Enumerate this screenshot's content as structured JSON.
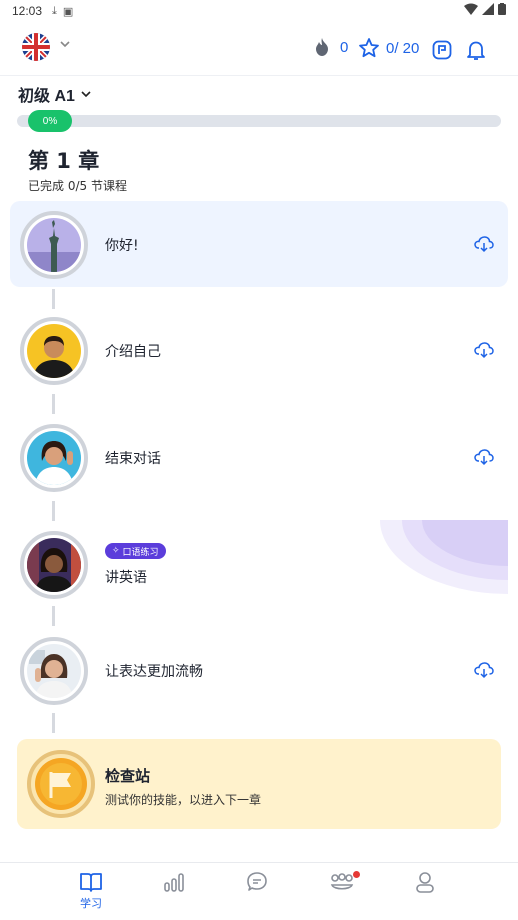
{
  "status_bar": {
    "time": "12:03"
  },
  "header": {
    "streak_count": "0",
    "stars_count": "0/ 20"
  },
  "level": {
    "label": "初级 A1",
    "progress_text": "0%",
    "progress": 0
  },
  "chapter": {
    "title": "第 1 章",
    "subtitle": "已完成 0/5 节课程"
  },
  "lessons": [
    {
      "label": "你好!"
    },
    {
      "label": "介绍自己"
    },
    {
      "label": "结束对话"
    },
    {
      "label": "讲英语",
      "badge": "口语练习"
    },
    {
      "label": "让表达更加流畅"
    }
  ],
  "checkpoint": {
    "title": "检查站",
    "subtitle": "测试你的技能，以进入下一章"
  },
  "bottom_nav": {
    "learn_label": "学习"
  },
  "colors": {
    "accent": "#1e63e6",
    "progress": "#19c26b",
    "badge": "#5b3ddb",
    "checkpoint_bg": "#fff2cc"
  }
}
